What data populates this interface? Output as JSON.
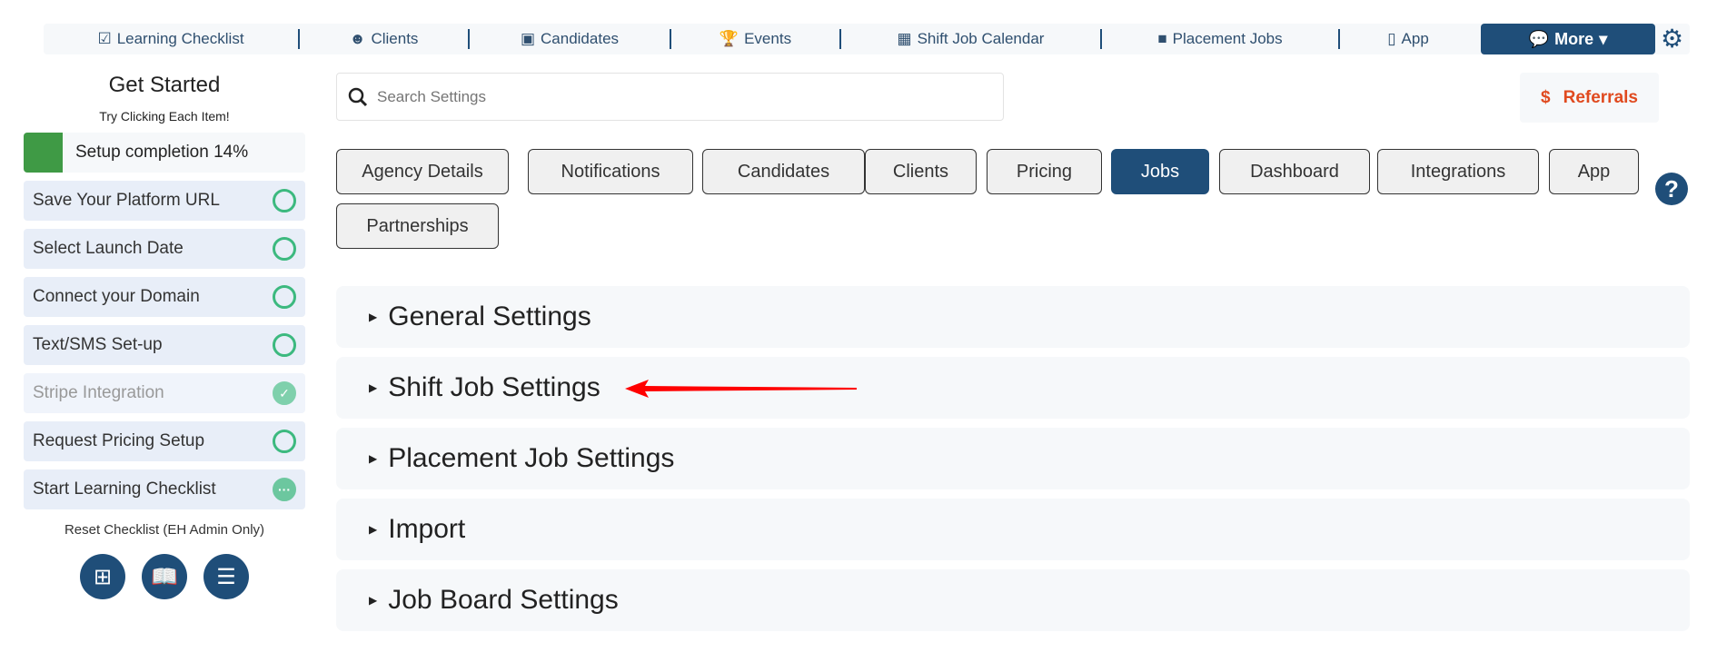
{
  "nav": {
    "items": [
      {
        "label": "Learning Checklist",
        "icon": "checklist-icon",
        "glyph": "☑"
      },
      {
        "label": "Clients",
        "icon": "clients-icon",
        "glyph": "☻"
      },
      {
        "label": "Candidates",
        "icon": "badge-icon",
        "glyph": "▣"
      },
      {
        "label": "Events",
        "icon": "trophy-icon",
        "glyph": "🏆"
      },
      {
        "label": "Shift Job Calendar",
        "icon": "calendar-icon",
        "glyph": "▦"
      },
      {
        "label": "Placement Jobs",
        "icon": "briefcase-icon",
        "glyph": "■"
      },
      {
        "label": "App",
        "icon": "phone-icon",
        "glyph": "▯"
      }
    ],
    "more_label": "More"
  },
  "sidebar": {
    "title": "Get Started",
    "subtitle": "Try Clicking Each Item!",
    "completion_label": "Setup completion 14%",
    "completion_percent": 14,
    "items": [
      {
        "label": "Save Your Platform URL",
        "status": "todo"
      },
      {
        "label": "Select Launch Date",
        "status": "todo"
      },
      {
        "label": "Connect your Domain",
        "status": "todo"
      },
      {
        "label": "Text/SMS Set-up",
        "status": "todo"
      },
      {
        "label": "Stripe Integration",
        "status": "done"
      },
      {
        "label": "Request Pricing Setup",
        "status": "todo"
      },
      {
        "label": "Start Learning Checklist",
        "status": "in-progress"
      }
    ],
    "reset_label": "Reset Checklist (EH Admin Only)"
  },
  "search": {
    "placeholder": "Search Settings"
  },
  "referrals": {
    "label": "Referrals",
    "color": "#e04a1f"
  },
  "tabs": [
    {
      "label": "Agency Details"
    },
    {
      "label": "Notifications"
    },
    {
      "label": "Candidates"
    },
    {
      "label": "Clients"
    },
    {
      "label": "Pricing"
    },
    {
      "label": "Jobs",
      "active": true
    },
    {
      "label": "Dashboard"
    },
    {
      "label": "Integrations"
    },
    {
      "label": "App"
    },
    {
      "label": "Partnerships"
    }
  ],
  "sections": [
    {
      "label": "General Settings"
    },
    {
      "label": "Shift Job Settings"
    },
    {
      "label": "Placement Job Settings"
    },
    {
      "label": "Import"
    },
    {
      "label": "Job Board Settings"
    }
  ],
  "colors": {
    "primary": "#1f4e79",
    "success": "#3cb97f",
    "progress": "#3f9a45",
    "annotation_arrow": "#ff0000"
  }
}
